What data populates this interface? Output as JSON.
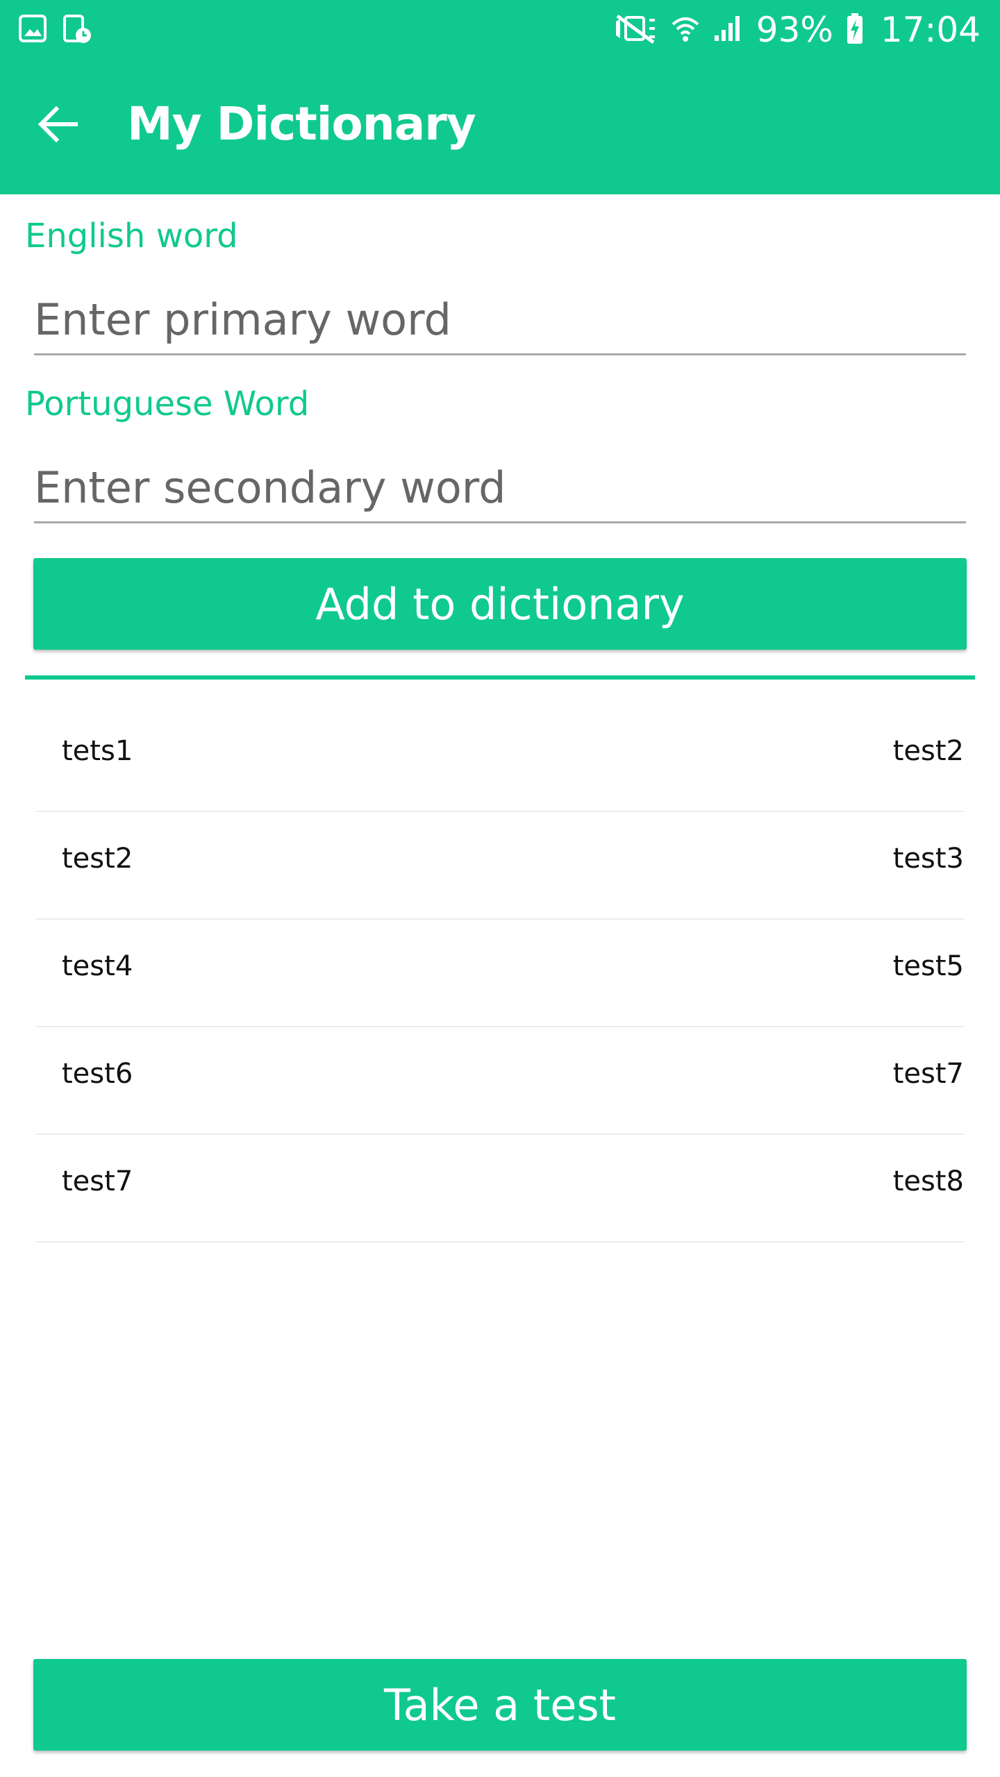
{
  "status_bar": {
    "battery": "93%",
    "time": "17:04",
    "icons_left": [
      "gallery-icon",
      "screen-timer-icon"
    ],
    "icons_right": [
      "vibrate-mute-icon",
      "wifi-icon",
      "signal-icon",
      "battery-charging-icon"
    ]
  },
  "app_bar": {
    "title": "My Dictionary",
    "back_icon": "arrow-back-icon"
  },
  "form": {
    "primary_label": "English word",
    "primary_placeholder": "Enter primary word",
    "primary_value": "",
    "secondary_label": "Portuguese Word",
    "secondary_placeholder": "Enter secondary word",
    "secondary_value": "",
    "add_button": "Add to dictionary"
  },
  "dictionary": [
    {
      "primary": "tets1",
      "secondary": "test2"
    },
    {
      "primary": "test2",
      "secondary": "test3"
    },
    {
      "primary": "test4",
      "secondary": "test5"
    },
    {
      "primary": "test6",
      "secondary": "test7"
    },
    {
      "primary": "test7",
      "secondary": "test8"
    }
  ],
  "footer": {
    "test_button": "Take a test"
  },
  "colors": {
    "accent": "#10C98F",
    "on_accent": "#FFFFFF",
    "input_underline": "#A9A9A9",
    "row_divider": "#ECECEC"
  }
}
